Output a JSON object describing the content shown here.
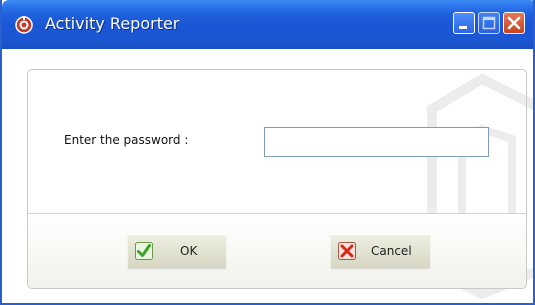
{
  "window": {
    "title": "Activity Reporter",
    "icons": {
      "app": "app-logo-icon",
      "minimize": "minimize-icon",
      "maximize": "maximize-icon",
      "close": "close-icon"
    }
  },
  "form": {
    "password_label": "Enter the password :",
    "password_value": "",
    "password_placeholder": ""
  },
  "buttons": {
    "ok_label": "OK",
    "ok_icon": "checkmark-icon",
    "cancel_label": "Cancel",
    "cancel_icon": "x-cross-icon"
  },
  "colors": {
    "titlebar": "#1f5fdc",
    "close_button": "#c6421c",
    "ok_check": "#3aa32a",
    "cancel_x": "#d62a1a"
  }
}
